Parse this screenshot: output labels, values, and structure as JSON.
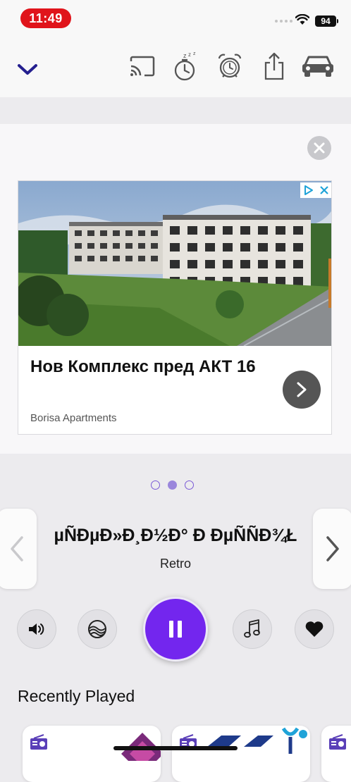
{
  "status_bar": {
    "time": "11:49",
    "battery": "94"
  },
  "toolbar": {
    "icons": [
      "chevron-down-icon",
      "cast-icon",
      "sleep-timer-icon",
      "alarm-icon",
      "share-icon",
      "car-mode-icon"
    ]
  },
  "ad": {
    "title": "Нов Комплекс пред АКТ 16",
    "advertiser": "Borisa Apartments"
  },
  "pager": {
    "count": 3,
    "active_index": 1
  },
  "station": {
    "name": "µÑÐµÐ»Ð¸Ð½Ð° Ð ÐµÑÑÐ¾Ł",
    "genre": "Retro"
  },
  "controls": {
    "icons": [
      "volume-icon",
      "equalizer-icon",
      "pause-icon",
      "music-note-icon",
      "heart-icon"
    ],
    "accent_color": "#7326ee"
  },
  "recently_played": {
    "title": "Recently Played"
  }
}
